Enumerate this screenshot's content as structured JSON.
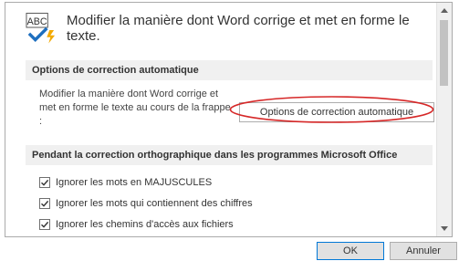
{
  "header": {
    "text": "Modifier la manière dont Word corrige et met en forme le texte.",
    "icon_label": "ABC"
  },
  "autocorrect_section": {
    "title": "Options de correction automatique",
    "description": "Modifier la manière dont Word corrige et met en forme le texte au cours de la frappe :",
    "button_label": "Options de correction automatique"
  },
  "spelling_section": {
    "title": "Pendant la correction orthographique dans les programmes Microsoft Office",
    "checks": [
      {
        "label": "Ignorer les mots en MAJUSCULES",
        "checked": true
      },
      {
        "label": "Ignorer les mots qui contiennent des chiffres",
        "checked": true
      },
      {
        "label": "Ignorer les chemins d'accès aux fichiers",
        "checked": true
      }
    ]
  },
  "buttons": {
    "ok": "OK",
    "cancel": "Annuler"
  },
  "colors": {
    "annotation": "#d62828",
    "accent": "#0078d7"
  }
}
